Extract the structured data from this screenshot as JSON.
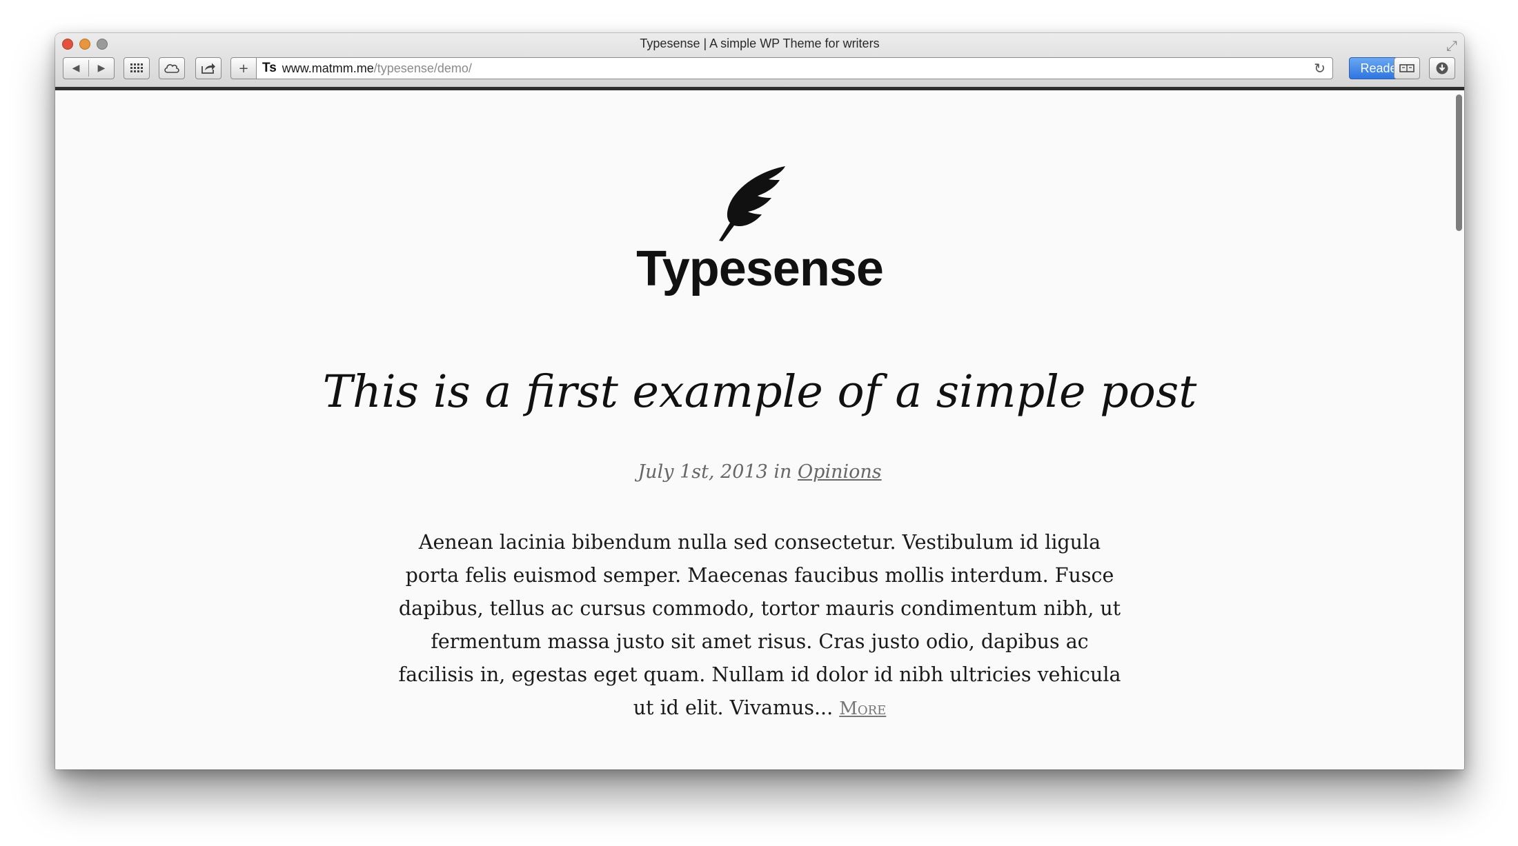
{
  "window": {
    "title": "Typesense | A simple WP Theme for writers"
  },
  "toolbar": {
    "back_icon": "back-arrow-icon",
    "forward_icon": "forward-arrow-icon",
    "favicon_text": "Ts",
    "url_host": "www.matmm.me",
    "url_path": "/typesense/demo/",
    "reader_label": "Reader"
  },
  "site": {
    "logo_icon": "feather-icon",
    "title": "Typesense"
  },
  "post": {
    "title": "This is a first example of a simple post",
    "date": "July 1st, 2013",
    "meta_in": "in",
    "category": "Opinions",
    "excerpt": "Aenean lacinia bibendum nulla sed consectetur. Vestibulum id ligula porta felis euismod semper. Maecenas faucibus mollis interdum. Fusce dapibus, tellus ac cursus commodo, tortor mauris condimentum nibh, ut fermentum massa justo sit amet risus. Cras justo odio, dapibus ac facilisis in, egestas eget quam. Nullam id dolor id nibh ultricies vehicula ut id elit. Vivamus...",
    "more_label": "More"
  },
  "colors": {
    "reader_button": "#2e75e0",
    "page_background": "#fafafa",
    "text": "#111111"
  }
}
